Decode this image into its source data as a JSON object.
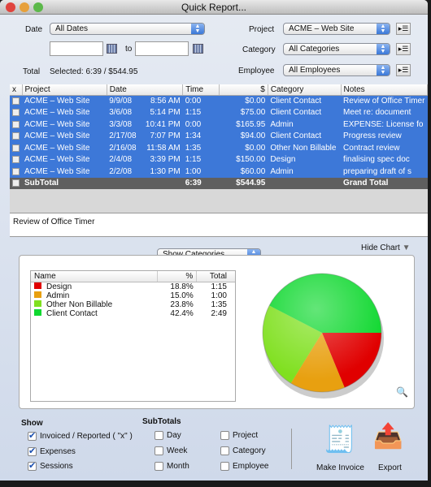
{
  "window": {
    "title": "Quick Report..."
  },
  "filters": {
    "date_label": "Date",
    "date_value": "All Dates",
    "to_label": "to",
    "from_value": "",
    "to_value": "",
    "total_label": "Total",
    "total_value": "Selected: 6:39 / $544.95",
    "project_label": "Project",
    "project_value": "ACME – Web Site",
    "category_label": "Category",
    "category_value": "All Categories",
    "employee_label": "Employee",
    "employee_value": "All Employees"
  },
  "table": {
    "columns": [
      "x",
      "Project",
      "Date",
      "",
      "Time",
      "$",
      "Category",
      "Notes"
    ],
    "rows": [
      [
        "ACME – Web Site",
        "9/9/08",
        "8:56 AM",
        "0:00",
        "$0.00",
        "Client Contact",
        "Review of Office Timer"
      ],
      [
        "ACME – Web Site",
        "3/6/08",
        "5:14 PM",
        "1:15",
        "$75.00",
        "Client Contact",
        "Meet re: document"
      ],
      [
        "ACME – Web Site",
        "3/3/08",
        "10:41 PM",
        "0:00",
        "$165.95",
        "Admin",
        "EXPENSE: License fo"
      ],
      [
        "ACME – Web Site",
        "2/17/08",
        "7:07 PM",
        "1:34",
        "$94.00",
        "Client Contact",
        "Progress review"
      ],
      [
        "ACME – Web Site",
        "2/16/08",
        "11:58 AM",
        "1:35",
        "$0.00",
        "Other Non Billable",
        "Contract review"
      ],
      [
        "ACME – Web Site",
        "2/4/08",
        "3:39 PM",
        "1:15",
        "$150.00",
        "Design",
        "finalising spec doc"
      ],
      [
        "ACME – Web Site",
        "2/2/08",
        "1:30 PM",
        "1:00",
        "$60.00",
        "Admin",
        "preparing draft of s"
      ]
    ],
    "subtotal": {
      "label": "SubTotal",
      "time": "6:39",
      "amount": "$544.95",
      "grand": "Grand Total"
    }
  },
  "notes_text": "Review of Office Timer",
  "chart": {
    "mode": "Show Categories",
    "hide_label": "Hide Chart"
  },
  "chart_data": {
    "type": "pie",
    "columns": [
      "Name",
      "%",
      "Total"
    ],
    "slices": [
      {
        "name": "Design",
        "percent": 18.8,
        "total": "1:15",
        "color": "#e00000"
      },
      {
        "name": "Admin",
        "percent": 15.0,
        "total": "1:00",
        "color": "#e8a010"
      },
      {
        "name": "Other Non Billable",
        "percent": 23.8,
        "total": "1:35",
        "color": "#80e020"
      },
      {
        "name": "Client Contact",
        "percent": 42.4,
        "total": "2:49",
        "color": "#10d830"
      }
    ]
  },
  "show": {
    "title": "Show",
    "items": [
      {
        "label": "Invoiced / Reported ( \"x\" )",
        "checked": true
      },
      {
        "label": "Expenses",
        "checked": true
      },
      {
        "label": "Sessions",
        "checked": true
      }
    ]
  },
  "subtotals": {
    "title": "SubTotals",
    "items": [
      {
        "label": "Day",
        "checked": false
      },
      {
        "label": "Week",
        "checked": false
      },
      {
        "label": "Month",
        "checked": false
      },
      {
        "label": "Project",
        "checked": false
      },
      {
        "label": "Category",
        "checked": false
      },
      {
        "label": "Employee",
        "checked": false
      }
    ]
  },
  "actions": {
    "invoice": "Make Invoice",
    "export": "Export"
  }
}
